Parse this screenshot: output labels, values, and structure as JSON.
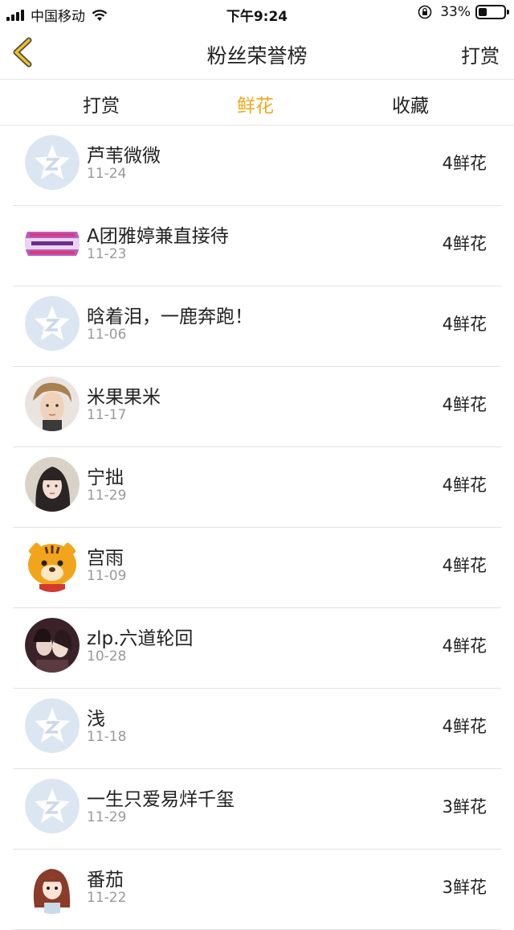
{
  "status_bar": {
    "carrier": "中国移动",
    "time": "下午9:24",
    "battery": "33%",
    "battery_level": 0.33
  },
  "nav": {
    "title": "粉丝荣誉榜",
    "right_action": "打赏"
  },
  "tabs": [
    {
      "label": "打赏",
      "active": false
    },
    {
      "label": "鲜花",
      "active": true
    },
    {
      "label": "收藏",
      "active": false
    }
  ],
  "colors": {
    "accent": "#f0a91c",
    "placeholder_avatar": "#dbe6f2"
  },
  "rows": [
    {
      "name": "芦苇微微",
      "date": "11-24",
      "amount": "4鲜花",
      "avatar": "default-avatar-icon"
    },
    {
      "name": "A团雅婷兼直接待",
      "date": "11-23",
      "amount": "4鲜花",
      "avatar": "banner-avatar"
    },
    {
      "name": "晗着泪，一鹿奔跑！",
      "date": "11-06",
      "amount": "4鲜花",
      "avatar": "default-avatar-icon"
    },
    {
      "name": "米果果米",
      "date": "11-17",
      "amount": "4鲜花",
      "avatar": "photo-avatar"
    },
    {
      "name": "宁拙",
      "date": "11-29",
      "amount": "4鲜花",
      "avatar": "photo-avatar"
    },
    {
      "name": "宫雨",
      "date": "11-09",
      "amount": "4鲜花",
      "avatar": "tiger-avatar"
    },
    {
      "name": "zlp.六道轮回",
      "date": "10-28",
      "amount": "4鲜花",
      "avatar": "photo-avatar"
    },
    {
      "name": "浅",
      "date": "11-18",
      "amount": "4鲜花",
      "avatar": "default-avatar-icon"
    },
    {
      "name": "一生只爱易烊千玺",
      "date": "11-29",
      "amount": "3鲜花",
      "avatar": "default-avatar-icon"
    },
    {
      "name": "番茄",
      "date": "11-22",
      "amount": "3鲜花",
      "avatar": "anime-avatar"
    }
  ]
}
